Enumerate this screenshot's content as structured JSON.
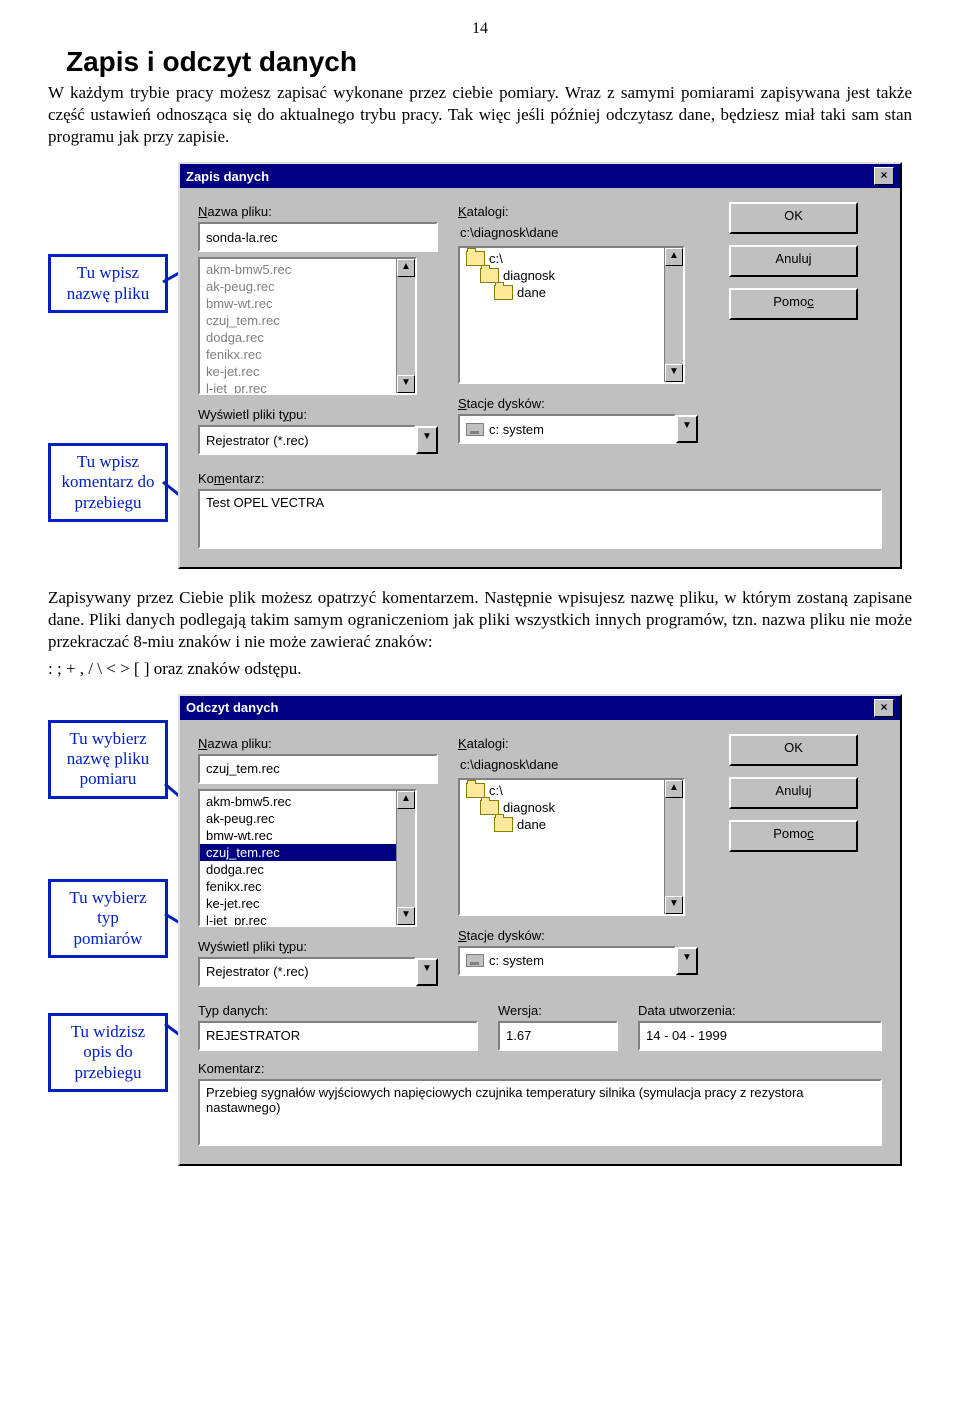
{
  "page_number": "14",
  "heading": "Zapis i odczyt danych",
  "intro": "W każdym trybie pracy możesz zapisać wykonane przez ciebie pomiary. Wraz z samymi pomiarami zapisywana jest także część ustawień odnosząca się do aktualnego trybu pracy. Tak więc jeśli później odczytasz dane, będziesz miał taki sam stan programu jak przy zapisie.",
  "callouts": {
    "c1": "Tu wpisz nazwę pliku",
    "c2": "Tu wpisz komentarz do przebiegu",
    "c3": "Tu wybierz nazwę pliku pomiaru",
    "c4": "Tu wybierz typ pomiarów",
    "c5": "Tu widzisz opis do przebiegu"
  },
  "mid_para": "Zapisywany przez Ciebie plik możesz opatrzyć komentarzem. Następnie wpisujesz nazwę pliku, w którym zostaną zapisane dane. Pliki danych podlegają takim samym ograniczeniom jak pliki wszystkich innych programów, tzn. nazwa pliku nie może przekraczać 8-miu znaków i nie może zawierać znaków:",
  "mid_para2": ": ; + , / \\ < > [ ] oraz znaków odstępu.",
  "dialog1": {
    "title": "Zapis danych",
    "labels": {
      "name": "Nazwa pliku:",
      "dirs": "Katalogi:",
      "path": "c:\\diagnosk\\dane",
      "filter": "Wyświetl pliki typu:",
      "drives": "Stacje dysków:",
      "comment": "Komentarz:"
    },
    "filename": "sonda-la.rec",
    "files": [
      "akm-bmw5.rec",
      "ak-peug.rec",
      "bmw-wt.rec",
      "czuj_tem.rec",
      "dodga.rec",
      "fenikx.rec",
      "ke-jet.rec",
      "l-jet_pr.rec"
    ],
    "dirs": [
      "c:\\",
      "diagnosk",
      "dane"
    ],
    "filter": "Rejestrator (*.rec)",
    "drive": "c: system",
    "comment": "Test OPEL VECTRA",
    "buttons": {
      "ok": "OK",
      "cancel": "Anuluj",
      "help": "Pomoc"
    }
  },
  "dialog2": {
    "title": "Odczyt danych",
    "labels": {
      "name": "Nazwa pliku:",
      "dirs": "Katalogi:",
      "path": "c:\\diagnosk\\dane",
      "filter": "Wyświetl pliki typu:",
      "drives": "Stacje dysków:",
      "type": "Typ danych:",
      "ver": "Wersja:",
      "date": "Data utworzenia:",
      "comment": "Komentarz:"
    },
    "filename": "czuj_tem.rec",
    "files": [
      "akm-bmw5.rec",
      "ak-peug.rec",
      "bmw-wt.rec",
      "czuj_tem.rec",
      "dodga.rec",
      "fenikx.rec",
      "ke-jet.rec",
      "l-jet_pr.rec"
    ],
    "dirs": [
      "c:\\",
      "diagnosk",
      "dane"
    ],
    "filter": "Rejestrator (*.rec)",
    "drive": "c: system",
    "type_val": "REJESTRATOR",
    "ver_val": "1.67",
    "date_val": "14 - 04 - 1999",
    "comment": "Przebieg sygnałów wyjściowych napięciowych czujnika temperatury silnika (symulacja pracy z rezystora nastawnego)",
    "buttons": {
      "ok": "OK",
      "cancel": "Anuluj",
      "help": "Pomoc"
    }
  }
}
